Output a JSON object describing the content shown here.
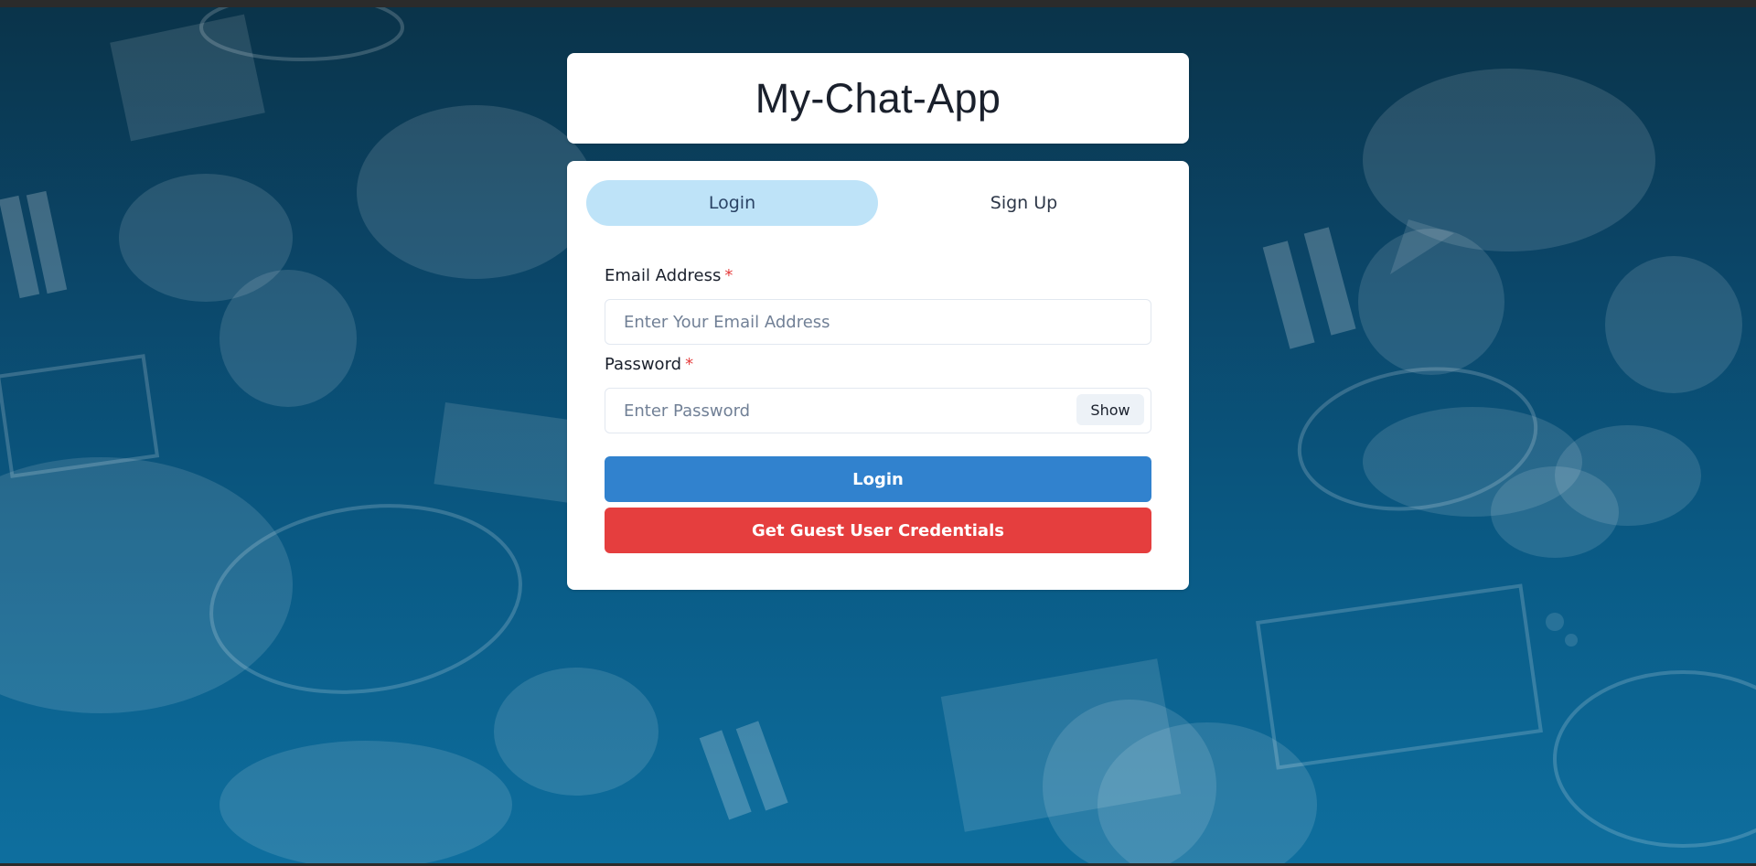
{
  "app": {
    "title": "My-Chat-App"
  },
  "tabs": [
    {
      "label": "Login",
      "active": true
    },
    {
      "label": "Sign Up",
      "active": false
    }
  ],
  "form": {
    "email": {
      "label": "Email Address",
      "required_marker": "*",
      "placeholder": "Enter Your Email Address",
      "value": ""
    },
    "password": {
      "label": "Password",
      "required_marker": "*",
      "placeholder": "Enter Password",
      "value": "",
      "toggle_label": "Show"
    },
    "login_button": "Login",
    "guest_button": "Get Guest User Credentials"
  },
  "colors": {
    "tab_active_bg": "#bee3f8",
    "primary_button": "#3182ce",
    "guest_button": "#e53e3e",
    "required_marker": "#e53e3e",
    "background_top": "#0a3349",
    "background_bottom": "#0e6f9f"
  }
}
